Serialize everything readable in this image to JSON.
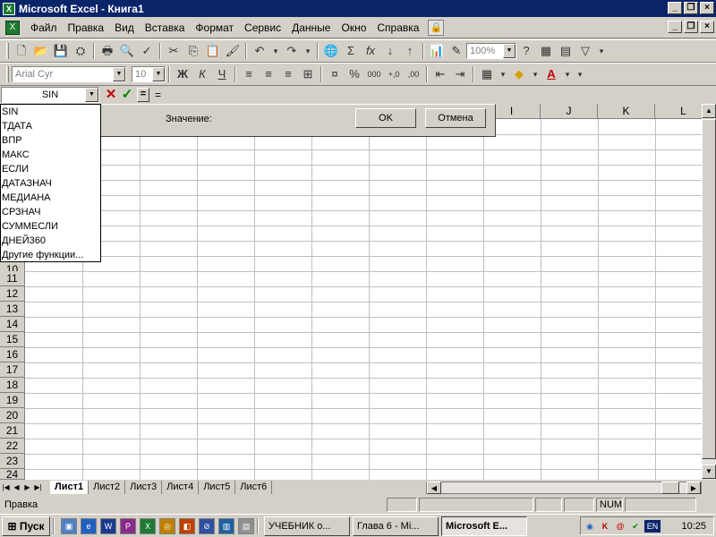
{
  "window": {
    "title": "Microsoft Excel - Книга1"
  },
  "menu": [
    "Файл",
    "Правка",
    "Вид",
    "Вставка",
    "Формат",
    "Сервис",
    "Данные",
    "Окно",
    "Справка"
  ],
  "toolbar": {
    "zoom": "100%",
    "font": "Arial Cyr",
    "font_size": "10",
    "bold": "Ж",
    "italic": "К",
    "underline": "Ч"
  },
  "formula_bar": {
    "name_box": "SIN",
    "content": "="
  },
  "dialog": {
    "value_label": "Значение:",
    "ok": "OK",
    "cancel": "Отмена"
  },
  "functions": [
    "SIN",
    "ТДАТА",
    "ВПР",
    "МАКС",
    "ЕСЛИ",
    "ДАТАЗНАЧ",
    "МЕДИАНА",
    "СРЗНАЧ",
    "СУММЕСЛИ",
    "ДНЕЙ360",
    "Другие функции..."
  ],
  "columns": [
    "I",
    "J",
    "K",
    "L"
  ],
  "rows": [
    "11",
    "12",
    "13",
    "14",
    "15",
    "16",
    "17",
    "18",
    "19",
    "20",
    "21",
    "22",
    "23",
    "24"
  ],
  "partial_row": "10",
  "sheets": [
    "Лист1",
    "Лист2",
    "Лист3",
    "Лист4",
    "Лист5",
    "Лист6"
  ],
  "status": {
    "text": "Правка",
    "num": "NUM"
  },
  "taskbar": {
    "start": "Пуск",
    "tasks": [
      "УЧЕБНИК о...",
      "Глава 6 - Mi...",
      "Microsoft E..."
    ],
    "tray_lang": "EN",
    "clock": "10:25"
  }
}
